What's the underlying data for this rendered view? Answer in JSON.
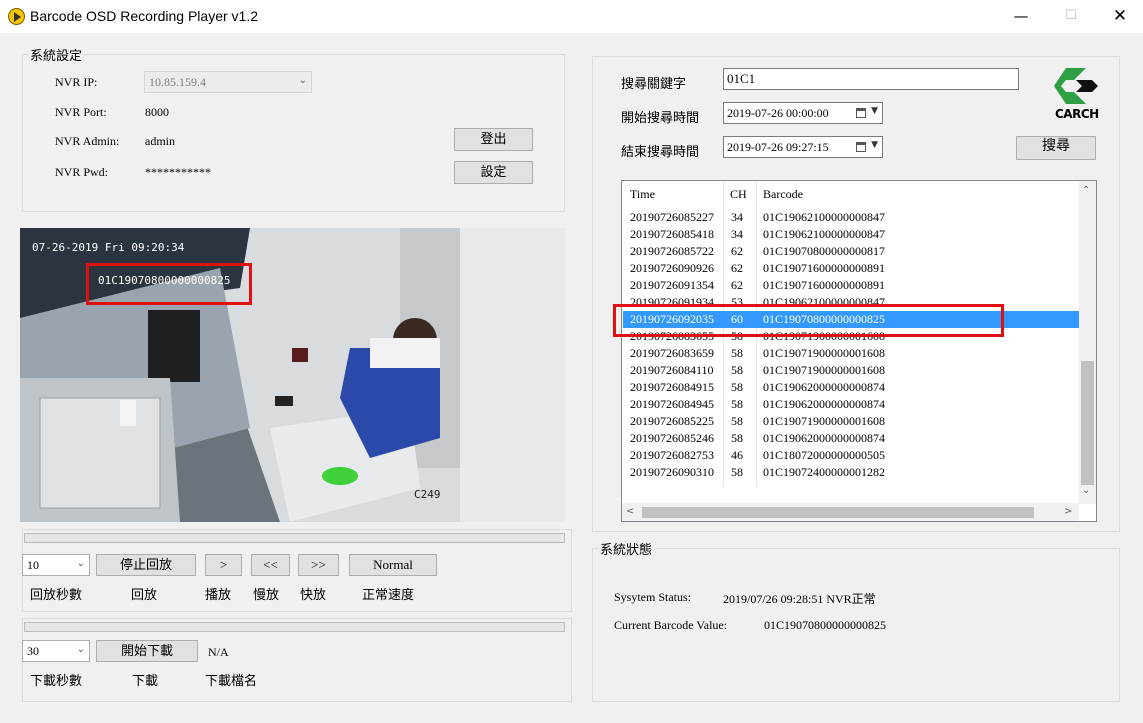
{
  "window": {
    "title": "Barcode OSD Recording Player v1.2",
    "minimize": "—",
    "maximize": "☐",
    "close": "✕"
  },
  "settings": {
    "group_title": "系統設定",
    "nvr_ip_label": "NVR IP:",
    "nvr_ip_value": "10.85.159.4",
    "nvr_port_label": "NVR Port:",
    "nvr_port_value": "8000",
    "nvr_admin_label": "NVR Admin:",
    "nvr_admin_value": "admin",
    "nvr_pwd_label": "NVR Pwd:",
    "nvr_pwd_value": "***********",
    "logout_button": "登出",
    "set_button": "設定"
  },
  "video": {
    "osd_time": "07-26-2019 Fri 09:20:34",
    "osd_barcode": "01C19070800000000825",
    "camera_label": "C249"
  },
  "playback": {
    "seconds_value": "10",
    "stop_button": "停止回放",
    "play_button": ">",
    "slow_button": "<<",
    "fast_button": ">>",
    "normal_button": "Normal",
    "seconds_label": "回放秒數",
    "replay_label": "回放",
    "play_label": "播放",
    "slow_label": "慢放",
    "fast_label": "快放",
    "normal_label": "正常速度"
  },
  "download": {
    "seconds_value": "30",
    "start_button": "開始下載",
    "filename_value": "N/A",
    "seconds_label": "下載秒數",
    "download_label": "下載",
    "filename_label": "下載檔名"
  },
  "search": {
    "keyword_label": "搜尋關鍵字",
    "keyword_value": "01C1",
    "start_label": "開始搜尋時間",
    "start_value": "2019-07-26 00:00:00",
    "end_label": "結束搜尋時間",
    "end_value": "2019-07-26 09:27:15",
    "search_button": "搜尋",
    "logo_text": "CARCH"
  },
  "results": {
    "columns": [
      "Time",
      "CH",
      "Barcode"
    ],
    "rows": [
      {
        "time": "20190726085227",
        "ch": "34",
        "barcode": "01C19062100000000847"
      },
      {
        "time": "20190726085418",
        "ch": "34",
        "barcode": "01C19062100000000847"
      },
      {
        "time": "20190726085722",
        "ch": "62",
        "barcode": "01C19070800000000817"
      },
      {
        "time": "20190726090926",
        "ch": "62",
        "barcode": "01C19071600000000891"
      },
      {
        "time": "20190726091354",
        "ch": "62",
        "barcode": "01C19071600000000891"
      },
      {
        "time": "20190726091934",
        "ch": "53",
        "barcode": "01C19062100000000847"
      },
      {
        "time": "20190726092035",
        "ch": "60",
        "barcode": "01C19070800000000825",
        "selected": true
      },
      {
        "time": "20190726083655",
        "ch": "58",
        "barcode": "01C19071900000001608"
      },
      {
        "time": "20190726083659",
        "ch": "58",
        "barcode": "01C19071900000001608"
      },
      {
        "time": "20190726084110",
        "ch": "58",
        "barcode": "01C19071900000001608"
      },
      {
        "time": "20190726084915",
        "ch": "58",
        "barcode": "01C19062000000000874"
      },
      {
        "time": "20190726084945",
        "ch": "58",
        "barcode": "01C19062000000000874"
      },
      {
        "time": "20190726085225",
        "ch": "58",
        "barcode": "01C19071900000001608"
      },
      {
        "time": "20190726085246",
        "ch": "58",
        "barcode": "01C19062000000000874"
      },
      {
        "time": "20190726082753",
        "ch": "46",
        "barcode": "01C18072000000000505"
      },
      {
        "time": "20190726090310",
        "ch": "58",
        "barcode": "01C19072400000001282"
      }
    ]
  },
  "status": {
    "group_title": "系統狀態",
    "system_status_label": "Sysytem Status:",
    "system_status_value": "2019/07/26 09:28:51 NVR正常",
    "barcode_label": "Current Barcode Value:",
    "barcode_value": "01C19070800000000825"
  },
  "colors": {
    "selection": "#3399ff",
    "highlight_box": "#e01010",
    "logo_green": "#2ea043"
  }
}
